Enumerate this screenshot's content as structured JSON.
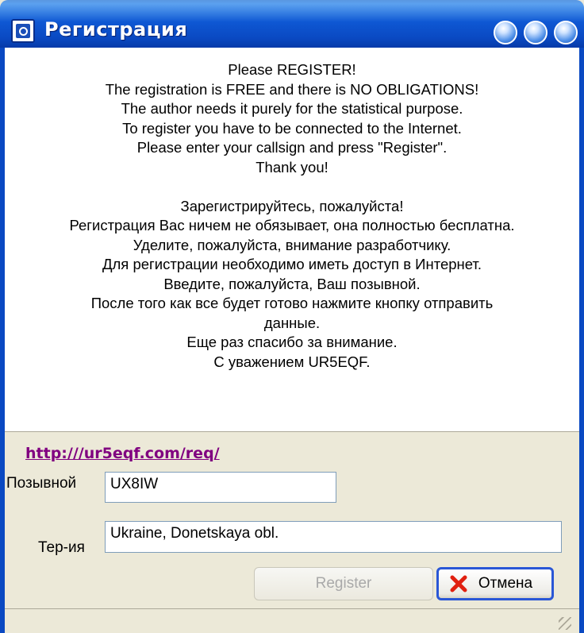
{
  "window": {
    "title": "Регистрация"
  },
  "message": {
    "lines_en": [
      "Please REGISTER!",
      "The registration is FREE and there is NO OBLIGATIONS!",
      "The author needs it purely for the statistical purpose.",
      "To register you have to be connected to the Internet.",
      "Please enter your callsign and press \"Register\".",
      "Thank you!"
    ],
    "lines_ru": [
      "Зарегистрируйтесь, пожалуйста!",
      "Регистрация Вас ничем не обязывает, она полностью бесплатна.",
      "Уделите, пожалуйста, внимание разработчику.",
      "Для регистрации необходимо иметь доступ в Интернет.",
      "Введите, пожалуйста, Ваш позывной.",
      "После того как все будет готово нажмите кнопку отправить",
      "данные.",
      "Еще раз спасибо за внимание.",
      "С уважением UR5EQF."
    ]
  },
  "link": {
    "text": "http:///ur5eqf.com/req/"
  },
  "form": {
    "callsign_label": "Позывной",
    "callsign_value": "UX8IW",
    "territory_label": "Тер-ия",
    "territory_value": "Ukraine, Donetskaya obl."
  },
  "buttons": {
    "register_label": "Register",
    "cancel_label": "Отмена"
  },
  "icons": {
    "app": "app-logo-icon",
    "cancel": "x-icon",
    "grip": "resize-grip-icon"
  },
  "colors": {
    "titlebar": "#0a49c2",
    "link": "#800080",
    "cancel_x": "#e02010"
  }
}
